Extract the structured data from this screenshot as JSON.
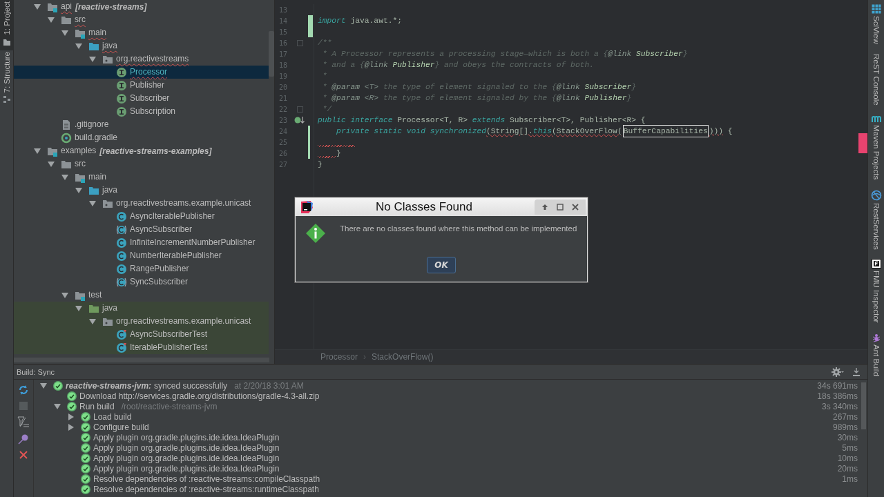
{
  "left_tool_tabs": [
    {
      "label": "1: Project",
      "selected": true
    },
    {
      "label": "7: Structure",
      "selected": false
    }
  ],
  "project_tree": [
    {
      "kind": "module",
      "name": "api",
      "module": "[reactive-streams]",
      "selected": false,
      "expanded": true,
      "error": true,
      "children": [
        {
          "kind": "folder",
          "name": "src",
          "selected": false,
          "expanded": true,
          "error": true,
          "children": [
            {
              "kind": "module-folder",
              "name": "main",
              "selected": false,
              "expanded": true,
              "error": true,
              "children": [
                {
                  "kind": "source-folder",
                  "name": "java",
                  "selected": false,
                  "expanded": true,
                  "error": true,
                  "children": [
                    {
                      "kind": "package",
                      "name": "org.reactivestreams",
                      "selected": false,
                      "expanded": true,
                      "error": true,
                      "children": [
                        {
                          "kind": "interface",
                          "name": "Processor",
                          "selected": true,
                          "error": true
                        },
                        {
                          "kind": "interface",
                          "name": "Publisher",
                          "selected": false,
                          "error": false
                        },
                        {
                          "kind": "interface",
                          "name": "Subscriber",
                          "selected": false,
                          "error": false
                        },
                        {
                          "kind": "interface",
                          "name": "Subscription",
                          "selected": false,
                          "error": false
                        }
                      ]
                    }
                  ]
                }
              ]
            }
          ]
        },
        {
          "kind": "file",
          "name": ".gitignore",
          "selected": false,
          "error": false
        },
        {
          "kind": "gradle",
          "name": "build.gradle",
          "selected": false,
          "error": false
        }
      ]
    },
    {
      "kind": "module",
      "name": "examples",
      "module": "[reactive-streams-examples]",
      "selected": false,
      "expanded": true,
      "error": false,
      "children": [
        {
          "kind": "folder",
          "name": "src",
          "selected": false,
          "expanded": true,
          "error": false,
          "children": [
            {
              "kind": "module-folder",
              "name": "main",
              "selected": false,
              "expanded": true,
              "error": false,
              "children": [
                {
                  "kind": "source-folder",
                  "name": "java",
                  "selected": false,
                  "expanded": true,
                  "error": false,
                  "children": [
                    {
                      "kind": "package",
                      "name": "org.reactivestreams.example.unicast",
                      "selected": false,
                      "expanded": true,
                      "error": false,
                      "children": [
                        {
                          "kind": "class",
                          "name": "AsyncIterablePublisher",
                          "selected": false,
                          "error": false
                        },
                        {
                          "kind": "abstract-class",
                          "name": "AsyncSubscriber",
                          "selected": false,
                          "error": false
                        },
                        {
                          "kind": "class",
                          "name": "InfiniteIncrementNumberPublisher",
                          "selected": false,
                          "error": false
                        },
                        {
                          "kind": "class",
                          "name": "NumberIterablePublisher",
                          "selected": false,
                          "error": false
                        },
                        {
                          "kind": "class",
                          "name": "RangePublisher",
                          "selected": false,
                          "error": false
                        },
                        {
                          "kind": "abstract-class",
                          "name": "SyncSubscriber",
                          "selected": false,
                          "error": false
                        }
                      ]
                    }
                  ]
                }
              ]
            },
            {
              "kind": "module-folder",
              "name": "test",
              "selected": false,
              "expanded": true,
              "error": false,
              "children": [
                {
                  "kind": "test-folder",
                  "name": "java",
                  "selected": false,
                  "expanded": true,
                  "error": false,
                  "children": [
                    {
                      "kind": "package",
                      "name": "org.reactivestreams.example.unicast",
                      "selected": false,
                      "expanded": true,
                      "error": false,
                      "children": [
                        {
                          "kind": "test-class",
                          "name": "AsyncSubscriberTest",
                          "selected": false,
                          "error": false
                        },
                        {
                          "kind": "test-class",
                          "name": "IterablePublisherTest",
                          "selected": false,
                          "error": false
                        }
                      ]
                    }
                  ]
                }
              ]
            }
          ]
        }
      ]
    }
  ],
  "editor": {
    "lines": [
      {
        "number": "13",
        "added": false,
        "modified": false,
        "fold": false,
        "implemented": false,
        "squiggle": false
      },
      {
        "number": "14",
        "added": true,
        "modified": false,
        "fold": false,
        "implemented": false,
        "squiggle": false,
        "tokens": [
          {
            "kind": "kw",
            "t": "import"
          },
          {
            "kind": "plain",
            "t": " java.awt.*;"
          }
        ]
      },
      {
        "number": "15",
        "added": true,
        "modified": false,
        "fold": false,
        "implemented": false,
        "squiggle": false
      },
      {
        "number": "16",
        "added": false,
        "modified": false,
        "fold": true,
        "implemented": false,
        "squiggle": false,
        "tokens": [
          {
            "kind": "comment",
            "t": "/**"
          }
        ]
      },
      {
        "number": "17",
        "added": false,
        "modified": false,
        "fold": false,
        "implemented": false,
        "squiggle": false,
        "tokens": [
          {
            "kind": "comment",
            "t": " * A Processor represents a processing stage—which is both a {"
          },
          {
            "kind": "doctag",
            "t": "@link"
          },
          {
            "kind": "docref",
            "t": " Subscriber"
          },
          {
            "kind": "comment",
            "t": "}"
          }
        ]
      },
      {
        "number": "18",
        "added": false,
        "modified": false,
        "fold": false,
        "implemented": false,
        "squiggle": false,
        "tokens": [
          {
            "kind": "comment",
            "t": " * and a {"
          },
          {
            "kind": "doctag",
            "t": "@link"
          },
          {
            "kind": "docref",
            "t": " Publisher"
          },
          {
            "kind": "comment",
            "t": "} and obeys the contracts of both."
          }
        ]
      },
      {
        "number": "19",
        "added": false,
        "modified": false,
        "fold": false,
        "implemented": false,
        "squiggle": false,
        "tokens": [
          {
            "kind": "comment",
            "t": " *"
          }
        ]
      },
      {
        "number": "20",
        "added": false,
        "modified": false,
        "fold": false,
        "implemented": false,
        "squiggle": false,
        "tokens": [
          {
            "kind": "comment",
            "t": " * "
          },
          {
            "kind": "doctag",
            "t": "@param"
          },
          {
            "kind": "docparam",
            "t": " <T>"
          },
          {
            "kind": "comment",
            "t": " the type of element signaled to the {"
          },
          {
            "kind": "doctag",
            "t": "@link"
          },
          {
            "kind": "docref",
            "t": " Subscriber"
          },
          {
            "kind": "comment",
            "t": "}"
          }
        ]
      },
      {
        "number": "21",
        "added": false,
        "modified": false,
        "fold": false,
        "implemented": false,
        "squiggle": false,
        "tokens": [
          {
            "kind": "comment",
            "t": " * "
          },
          {
            "kind": "doctag",
            "t": "@param"
          },
          {
            "kind": "docparam",
            "t": " <R>"
          },
          {
            "kind": "comment",
            "t": " the type of element signaled by the {"
          },
          {
            "kind": "doctag",
            "t": "@link"
          },
          {
            "kind": "docref",
            "t": " Publisher"
          },
          {
            "kind": "comment",
            "t": "}"
          }
        ]
      },
      {
        "number": "22",
        "added": false,
        "modified": false,
        "fold": true,
        "implemented": false,
        "squiggle": false,
        "tokens": [
          {
            "kind": "comment",
            "t": " */"
          }
        ]
      },
      {
        "number": "23",
        "added": false,
        "modified": false,
        "fold": false,
        "implemented": true,
        "squiggle": false,
        "tokens": [
          {
            "kind": "kw",
            "t": "public interface"
          },
          {
            "kind": "plain",
            "t": " Processor<T, R> "
          },
          {
            "kind": "kw",
            "t": "extends"
          },
          {
            "kind": "plain",
            "t": " Subscriber<T>, Publisher<R> {"
          }
        ]
      },
      {
        "number": "24",
        "added": false,
        "modified": true,
        "fold": false,
        "implemented": false,
        "squiggle": false,
        "tokens": [
          {
            "kind": "kw",
            "t": "    private static void synchronized"
          },
          {
            "kind": "error",
            "t": "(String[]."
          },
          {
            "kind": "kwerror",
            "t": "this"
          },
          {
            "kind": "error",
            "t": "(StackOverFlow("
          },
          {
            "kind": "boxed",
            "t": "BufferCapabilities"
          },
          {
            "kind": "error",
            "t": ")))"
          },
          {
            "kind": "plain",
            "t": " {"
          }
        ]
      },
      {
        "number": "25",
        "added": false,
        "modified": true,
        "fold": false,
        "implemented": false,
        "squiggle": true
      },
      {
        "number": "26",
        "added": false,
        "modified": true,
        "fold": false,
        "implemented": false,
        "squiggle": true,
        "tokens": [
          {
            "kind": "plain",
            "t": "}"
          }
        ]
      },
      {
        "number": "27",
        "added": false,
        "modified": false,
        "fold": false,
        "implemented": false,
        "squiggle": false,
        "tokens": [
          {
            "kind": "plain",
            "t": "}"
          }
        ]
      }
    ],
    "breadcrumbs": [
      "Processor",
      "StackOverFlow()"
    ],
    "breadcrumb_separator": "›"
  },
  "dialog": {
    "title": "No Classes Found",
    "message": "There are no classes found where this method can be implemented",
    "button": "OK"
  },
  "right_tool_tabs": [
    {
      "label": "SciView",
      "kind": "grid"
    },
    {
      "label": "ReST Console",
      "kind": "none"
    },
    {
      "label": "Maven Projects",
      "kind": "maven"
    },
    {
      "label": "RestServices",
      "kind": "globe"
    },
    {
      "label": "FMU Inspector",
      "kind": "fmu"
    },
    {
      "label": "Ant Build",
      "kind": "ant"
    }
  ],
  "build": {
    "title": "Build: Sync",
    "rows": [
      {
        "succeeded": true,
        "title": "reactive-streams-jvm:",
        "text": "synced successfully",
        "detail": "at 2/20/18 3:01 AM",
        "duration": "34s 691ms",
        "expanded": true,
        "children": [
          {
            "succeeded": true,
            "text": "Download http://services.gradle.org/distributions/gradle-4.3-all.zip",
            "duration": "18s 386ms"
          },
          {
            "succeeded": true,
            "text": "Run build",
            "detail": "/root/reactive-streams-jvm",
            "duration": "3s 340ms",
            "expanded": true,
            "children": [
              {
                "succeeded": true,
                "text": "Load build",
                "duration": "267ms",
                "expanded": false
              },
              {
                "succeeded": true,
                "text": "Configure build",
                "duration": "989ms",
                "expanded": false
              },
              {
                "succeeded": true,
                "text": "Apply plugin org.gradle.plugins.ide.idea.IdeaPlugin",
                "duration": "30ms"
              },
              {
                "succeeded": true,
                "text": "Apply plugin org.gradle.plugins.ide.idea.IdeaPlugin",
                "duration": "5ms"
              },
              {
                "succeeded": true,
                "text": "Apply plugin org.gradle.plugins.ide.idea.IdeaPlugin",
                "duration": "10ms"
              },
              {
                "succeeded": true,
                "text": "Apply plugin org.gradle.plugins.ide.idea.IdeaPlugin",
                "duration": "20ms"
              },
              {
                "succeeded": true,
                "text": "Resolve dependencies of :reactive-streams:compileClasspath",
                "duration": "1ms"
              },
              {
                "succeeded": true,
                "text": "Resolve dependencies of :reactive-streams:runtimeClasspath"
              }
            ]
          }
        ]
      }
    ]
  }
}
